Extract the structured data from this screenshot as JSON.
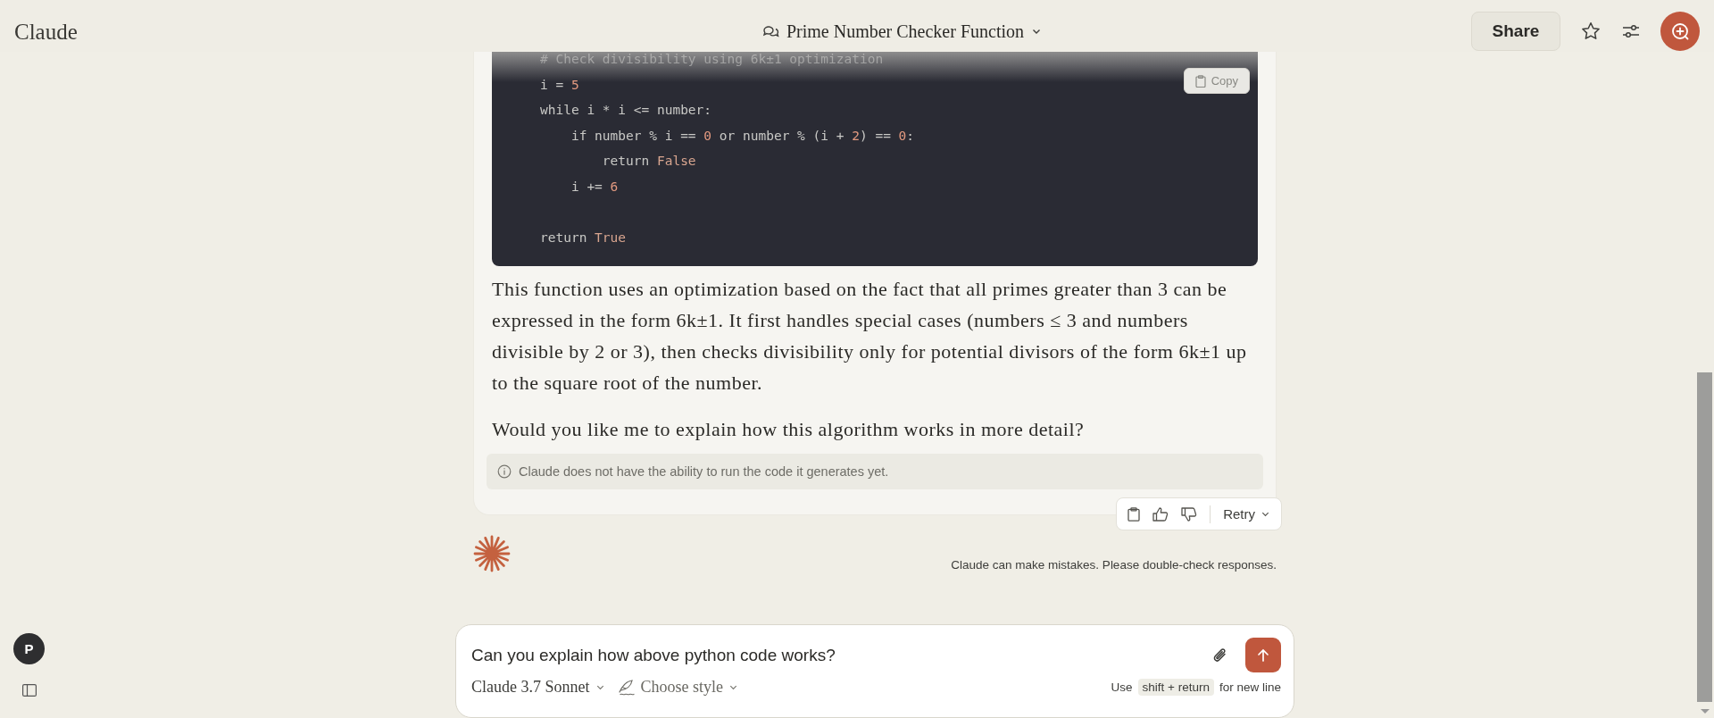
{
  "header": {
    "logo": "Claude",
    "title": "Prime Number Checker Function",
    "share": "Share"
  },
  "code": {
    "copy_label": "Copy",
    "lines": [
      {
        "gap_before": false,
        "tokens": [
          {
            "kind": "comment",
            "text": "# Check divisibility using 6k±1 optimization"
          }
        ]
      },
      {
        "gap_before": false,
        "tokens": [
          {
            "kind": "plain",
            "text": "i = "
          },
          {
            "kind": "number",
            "text": "5"
          }
        ]
      },
      {
        "gap_before": false,
        "tokens": [
          {
            "kind": "plain",
            "text": "while i * i <= number:"
          }
        ]
      },
      {
        "gap_before": false,
        "tokens": [
          {
            "kind": "plain",
            "text": "    if number % i == "
          },
          {
            "kind": "number",
            "text": "0"
          },
          {
            "kind": "plain",
            "text": " or number % (i + "
          },
          {
            "kind": "number",
            "text": "2"
          },
          {
            "kind": "plain",
            "text": ") == "
          },
          {
            "kind": "number",
            "text": "0"
          },
          {
            "kind": "plain",
            "text": ":"
          }
        ]
      },
      {
        "gap_before": false,
        "tokens": [
          {
            "kind": "plain",
            "text": "        return "
          },
          {
            "kind": "constant",
            "text": "False"
          }
        ]
      },
      {
        "gap_before": false,
        "tokens": [
          {
            "kind": "plain",
            "text": "    i += "
          },
          {
            "kind": "number",
            "text": "6"
          }
        ]
      },
      {
        "gap_before": true,
        "tokens": [
          {
            "kind": "plain",
            "text": "return "
          },
          {
            "kind": "constant",
            "text": "True"
          }
        ]
      }
    ]
  },
  "paragraphs": [
    "This function uses an optimization based on the fact that all primes greater than 3 can be expressed in the form 6k±1. It first handles special cases (numbers ≤ 3 and numbers divisible by 2 or 3), then checks divisibility only for potential divisors of the form 6k±1 up to the square root of the number.",
    "Would you like me to explain how this algorithm works in more detail?"
  ],
  "note": "Claude does not have the ability to run the code it generates yet.",
  "actions": {
    "retry": "Retry"
  },
  "disclaimer": "Claude can make mistakes. Please double-check responses.",
  "composer": {
    "value": "Can you explain how above python code works?",
    "model": "Claude 3.7 Sonnet",
    "style": "Choose style",
    "hint_before": "Use",
    "hint_key": "shift + return",
    "hint_after": "for new line"
  },
  "user": {
    "initial": "P"
  }
}
